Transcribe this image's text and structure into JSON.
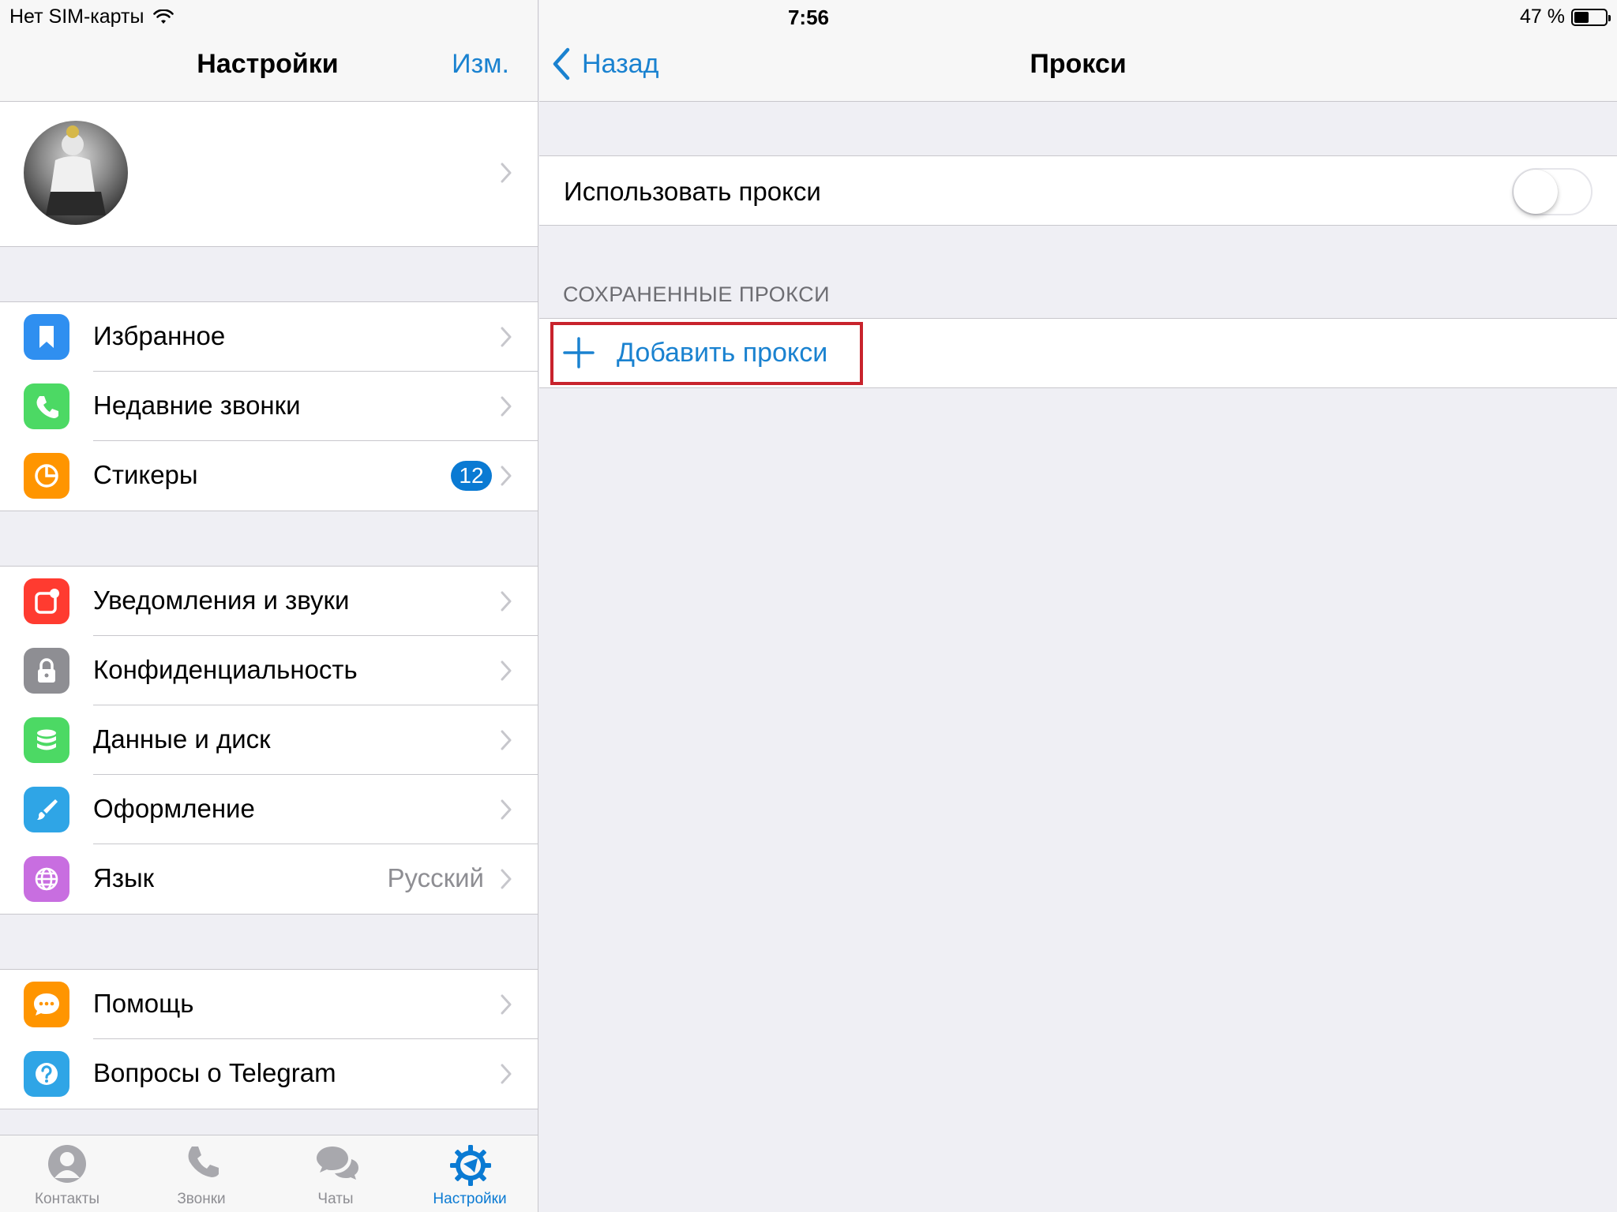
{
  "status_bar": {
    "carrier": "Нет SIM-карты",
    "time": "7:56",
    "battery_text": "47 %",
    "battery_level": 0.47
  },
  "settings": {
    "title": "Настройки",
    "edit_label": "Изм.",
    "group1": [
      {
        "label": "Избранное",
        "icon": "bookmark-icon",
        "color": "#2f8ff0"
      },
      {
        "label": "Недавние звонки",
        "icon": "phone-icon",
        "color": "#4cd964"
      },
      {
        "label": "Стикеры",
        "icon": "sticker-icon",
        "color": "#ff9500",
        "badge": "12"
      }
    ],
    "group2": [
      {
        "label": "Уведомления и звуки",
        "icon": "notification-icon",
        "color": "#ff3b30"
      },
      {
        "label": "Конфиденциальность",
        "icon": "lock-icon",
        "color": "#8e8e93"
      },
      {
        "label": "Данные и диск",
        "icon": "database-icon",
        "color": "#4cd964"
      },
      {
        "label": "Оформление",
        "icon": "brush-icon",
        "color": "#2fa5e6"
      },
      {
        "label": "Язык",
        "icon": "globe-icon",
        "color": "#c86ee0",
        "detail": "Русский"
      }
    ],
    "group3": [
      {
        "label": "Помощь",
        "icon": "chat-bubble-icon",
        "color": "#ff9500"
      },
      {
        "label": "Вопросы о Telegram",
        "icon": "question-icon",
        "color": "#2fa5e6"
      }
    ]
  },
  "tab_bar": [
    {
      "label": "Контакты",
      "icon": "person-icon"
    },
    {
      "label": "Звонки",
      "icon": "phone-icon"
    },
    {
      "label": "Чаты",
      "icon": "chat-bubbles-icon"
    },
    {
      "label": "Настройки",
      "icon": "gear-icon",
      "active": true
    }
  ],
  "proxy": {
    "back_label": "Назад",
    "title": "Прокси",
    "use_proxy_label": "Использовать прокси",
    "use_proxy_on": false,
    "saved_header": "СОХРАНЕННЫЕ ПРОКСИ",
    "add_label": "Добавить прокси"
  },
  "colors": {
    "accent": "#1a82d0",
    "badge": "#0a7ad3",
    "highlight": "#c8232c"
  }
}
